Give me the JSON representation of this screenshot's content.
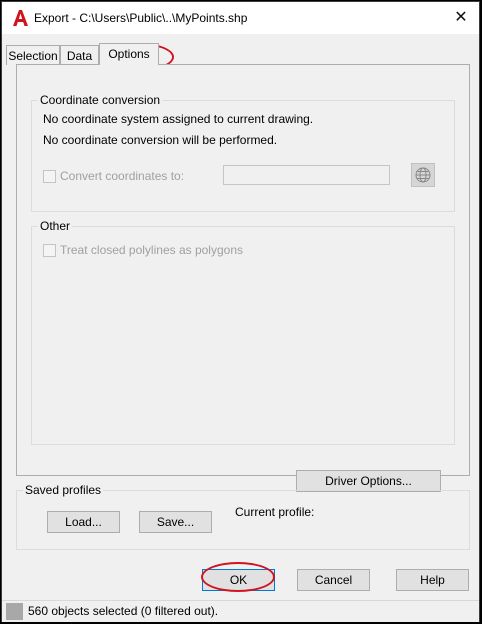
{
  "window": {
    "title": "Export - C:\\Users\\Public\\..\\MyPoints.shp",
    "close_glyph": "✕",
    "app_icon": "autocad-a-icon",
    "accent_red": "#d0141e"
  },
  "tabs": [
    {
      "label": "Selection"
    },
    {
      "label": "Data"
    },
    {
      "label": "Options",
      "active": true
    }
  ],
  "coordinate_conversion": {
    "group_label": "Coordinate conversion",
    "line1": "No coordinate system assigned to current drawing.",
    "line2": "No coordinate conversion will be performed.",
    "convert_label": "Convert coordinates to:",
    "convert_checked": false,
    "target_value": "",
    "globe_icon": "globe-icon"
  },
  "other": {
    "group_label": "Other",
    "treat_polylines_label": "Treat closed polylines as polygons",
    "treat_polylines_checked": false
  },
  "driver_options_label": "Driver Options...",
  "saved_profiles": {
    "group_label": "Saved profiles",
    "load_label": "Load...",
    "save_label": "Save...",
    "current_profile_label": "Current profile:",
    "current_profile_value": ""
  },
  "footer": {
    "ok_label": "OK",
    "cancel_label": "Cancel",
    "help_label": "Help"
  },
  "status": {
    "text": "560 objects selected (0 filtered out)."
  }
}
